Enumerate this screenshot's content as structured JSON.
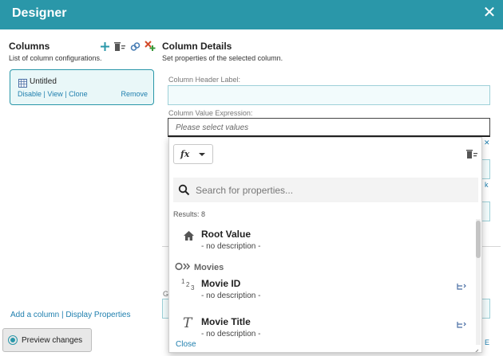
{
  "window": {
    "title": "Designer",
    "close_icon": "close-icon"
  },
  "columns": {
    "heading": "Columns",
    "subtitle": "List of column configurations.",
    "items": [
      {
        "name": "Untitled",
        "disable": "Disable",
        "view": "View",
        "clone": "Clone",
        "remove": "Remove"
      }
    ],
    "add_column": "Add a column",
    "display_properties": "Display Properties"
  },
  "details": {
    "heading": "Column Details",
    "subtitle": "Set properties of the selected column.",
    "header_label": "Column Header Label:",
    "header_value": "",
    "value_label": "Column Value Expression:",
    "value_placeholder": "Please select values"
  },
  "preview": {
    "label": "Preview changes"
  },
  "dropdown": {
    "fx_label": "fx",
    "search_placeholder": "Search for properties...",
    "results": "Results: 8",
    "items": [
      {
        "name": "Root Value",
        "desc": "- no description -",
        "icon": "home-icon"
      },
      {
        "group": "Movies"
      },
      {
        "name": "Movie ID",
        "desc": "- no description -",
        "icon": "numeric-icon"
      },
      {
        "name": "Movie Title",
        "desc": "- no description -",
        "icon": "text-type-icon"
      }
    ],
    "close": "Close"
  },
  "colors": {
    "accent": "#2a97a9",
    "link": "#1f7fae"
  }
}
